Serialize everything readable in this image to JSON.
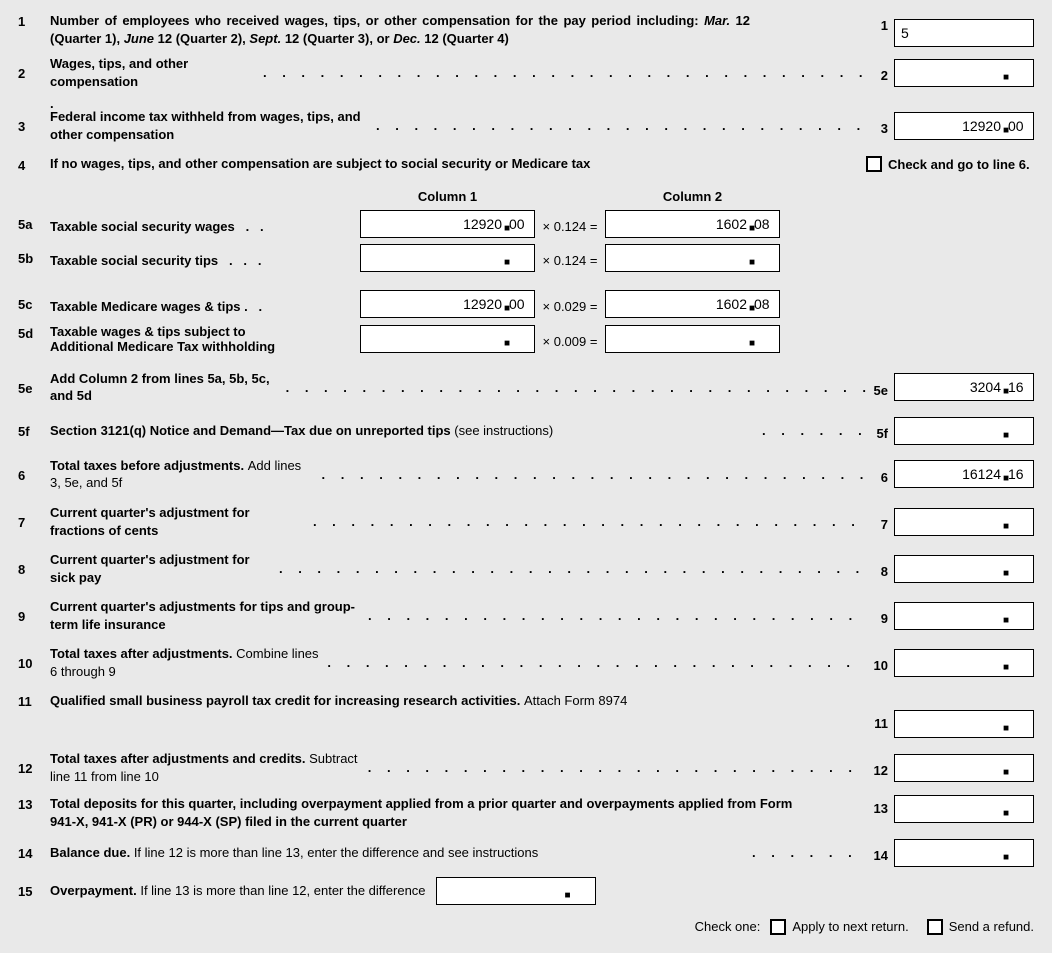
{
  "dots": ".  .  .  .  .  .  .  .  .  .  .  .  .  .  .  .  .  .  .  .  .  .  .  .  .  .  .  .  .  .  .  .  .  .  .",
  "line1": {
    "num": "1",
    "text_a": "Number of employees who received wages, tips, or other compensation for the pay period including: ",
    "m1": "Mar.",
    "t1": " 12 (Quarter 1), ",
    "m2": "June",
    "t2": " 12 (Quarter 2), ",
    "m3": "Sept.",
    "t3": " 12 (Quarter 3), or ",
    "m4": "Dec.",
    "t4": " 12 (Quarter 4)",
    "rn": "1",
    "val": "5"
  },
  "line2": {
    "num": "2",
    "text": "Wages, tips, and other compensation",
    "rn": "2",
    "int": "",
    "frac": ""
  },
  "line3": {
    "num": "3",
    "text": "Federal income tax withheld from wages, tips, and other compensation",
    "rn": "3",
    "int": "12920",
    "frac": "00"
  },
  "line4": {
    "num": "4",
    "text": "If no wages, tips, and other compensation are subject to social security or Medicare tax",
    "chk": "Check and go to line 6."
  },
  "col1_hdr": "Column 1",
  "col2_hdr": "Column 2",
  "l5a": {
    "num": "5a",
    "text": "Taxable social security wages",
    "c1_int": "12920",
    "c1_frac": "00",
    "mult": "× 0.124 =",
    "c2_int": "1602",
    "c2_frac": "08"
  },
  "l5b": {
    "num": "5b",
    "text": "Taxable social security tips",
    "c1_int": "",
    "c1_frac": "",
    "mult": "× 0.124 =",
    "c2_int": "",
    "c2_frac": ""
  },
  "l5c": {
    "num": "5c",
    "text": "Taxable Medicare wages & tips",
    "c1_int": "12920",
    "c1_frac": "00",
    "mult": "× 0.029 =",
    "c2_int": "1602",
    "c2_frac": "08"
  },
  "l5d": {
    "num": "5d",
    "text_a": "Taxable wages & tips subject to",
    "text_b": "Additional Medicare Tax withholding",
    "c1_int": "",
    "c1_frac": "",
    "mult": "× 0.009 =",
    "c2_int": "",
    "c2_frac": ""
  },
  "l5e": {
    "num": "5e",
    "text": "Add Column 2 from lines 5a, 5b, 5c, and 5d",
    "rn": "5e",
    "int": "3204",
    "frac": "16"
  },
  "l5f": {
    "num": "5f",
    "text_b": "Section 3121(q) Notice and Demand—Tax due on unreported tips ",
    "text_n": "(see instructions)",
    "rn": "5f",
    "int": "",
    "frac": ""
  },
  "l6": {
    "num": "6",
    "text_b": "Total taxes before adjustments. ",
    "text_n": "Add lines 3, 5e, and 5f",
    "rn": "6",
    "int": "16124",
    "frac": "16"
  },
  "l7": {
    "num": "7",
    "text": "Current quarter's adjustment for fractions of cents",
    "rn": "7",
    "int": "",
    "frac": ""
  },
  "l8": {
    "num": "8",
    "text": "Current quarter's adjustment for sick pay",
    "rn": "8",
    "int": "",
    "frac": ""
  },
  "l9": {
    "num": "9",
    "text": "Current quarter's adjustments for tips and group-term life insurance",
    "rn": "9",
    "int": "",
    "frac": ""
  },
  "l10": {
    "num": "10",
    "text_b": "Total taxes after adjustments. ",
    "text_n": "Combine lines 6 through 9",
    "rn": "10",
    "int": "",
    "frac": ""
  },
  "l11": {
    "num": "11",
    "text_b": "Qualified small business payroll tax credit for increasing research activities. ",
    "text_n": "Attach Form 8974",
    "rn": "11",
    "int": "",
    "frac": ""
  },
  "l12": {
    "num": "12",
    "text_b": "Total taxes after adjustments and credits. ",
    "text_n": "Subtract line 11 from line 10",
    "rn": "12",
    "int": "",
    "frac": ""
  },
  "l13": {
    "num": "13",
    "text": "Total deposits for this quarter, including overpayment applied from a prior quarter and overpayments applied from Form 941-X, 941-X (PR) or 944-X (SP) filed in the current quarter",
    "rn": "13",
    "int": "",
    "frac": ""
  },
  "l14": {
    "num": "14",
    "text_b": "Balance due. ",
    "text_n": "If line 12 is more than line 13, enter the difference and see instructions",
    "rn": "14",
    "int": "",
    "frac": ""
  },
  "l15": {
    "num": "15",
    "text_b": "Overpayment. ",
    "text_n": "If line 13 is more than line 12, enter the difference",
    "int": "",
    "frac": ""
  },
  "footer": {
    "check_one": "Check one:",
    "opt1": "Apply to next return.",
    "opt2": "Send a refund."
  }
}
